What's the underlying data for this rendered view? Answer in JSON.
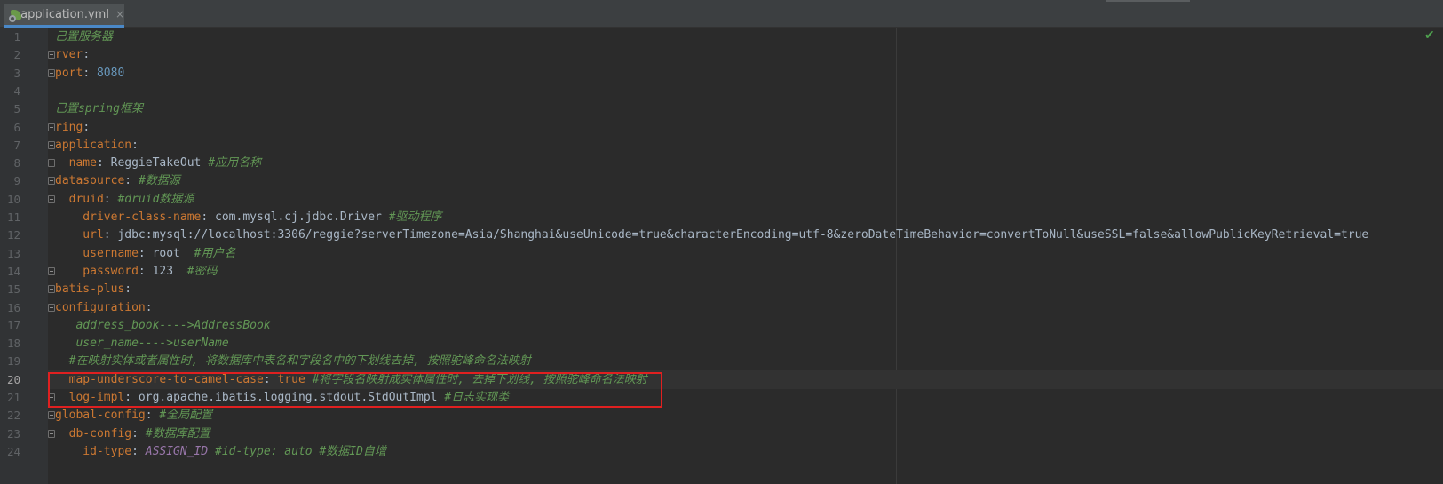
{
  "tab": {
    "label": "application.yml",
    "close": "×"
  },
  "status": {
    "check": "✔"
  },
  "lines": [
    {
      "num": "1",
      "tokens": [
        {
          "t": "c",
          "x": "己置服务器"
        }
      ]
    },
    {
      "num": "2",
      "fold": true,
      "tokens": [
        {
          "t": "k",
          "x": "rver"
        },
        {
          "t": "v",
          "x": ":"
        }
      ]
    },
    {
      "num": "3",
      "fold": true,
      "tokens": [
        {
          "t": "k",
          "x": "port"
        },
        {
          "t": "v",
          "x": ": "
        },
        {
          "t": "n",
          "x": "8080"
        }
      ]
    },
    {
      "num": "4",
      "tokens": []
    },
    {
      "num": "5",
      "tokens": [
        {
          "t": "c",
          "x": "己置spring框架"
        }
      ]
    },
    {
      "num": "6",
      "fold": true,
      "tokens": [
        {
          "t": "k",
          "x": "ring"
        },
        {
          "t": "v",
          "x": ":"
        }
      ]
    },
    {
      "num": "7",
      "fold": true,
      "tokens": [
        {
          "t": "k",
          "x": "application"
        },
        {
          "t": "v",
          "x": ":"
        }
      ]
    },
    {
      "num": "8",
      "fold": true,
      "tokens": [
        {
          "t": "k",
          "x": "  name"
        },
        {
          "t": "v",
          "x": ": ReggieTakeOut "
        },
        {
          "t": "c",
          "x": "#应用名称"
        }
      ]
    },
    {
      "num": "9",
      "fold": true,
      "tokens": [
        {
          "t": "k",
          "x": "datasource"
        },
        {
          "t": "v",
          "x": ": "
        },
        {
          "t": "c",
          "x": "#数据源"
        }
      ]
    },
    {
      "num": "10",
      "fold": true,
      "tokens": [
        {
          "t": "k",
          "x": "  druid"
        },
        {
          "t": "v",
          "x": ": "
        },
        {
          "t": "c",
          "x": "#druid数据源"
        }
      ]
    },
    {
      "num": "11",
      "tokens": [
        {
          "t": "k",
          "x": "    driver-class-name"
        },
        {
          "t": "v",
          "x": ": com.mysql.cj.jdbc.Driver "
        },
        {
          "t": "c",
          "x": "#驱动程序"
        }
      ]
    },
    {
      "num": "12",
      "tokens": [
        {
          "t": "k",
          "x": "    url"
        },
        {
          "t": "v",
          "x": ": jdbc:mysql://localhost:3306/reggie?serverTimezone=Asia/Shanghai&useUnicode=true&characterEncoding=utf-8&zeroDateTimeBehavior=convertToNull&useSSL=false&allowPublicKeyRetrieval=true"
        }
      ]
    },
    {
      "num": "13",
      "tokens": [
        {
          "t": "k",
          "x": "    username"
        },
        {
          "t": "v",
          "x": ": root  "
        },
        {
          "t": "c",
          "x": "#用户名"
        }
      ]
    },
    {
      "num": "14",
      "fold": true,
      "tokens": [
        {
          "t": "k",
          "x": "    password"
        },
        {
          "t": "v",
          "x": ": 123  "
        },
        {
          "t": "c",
          "x": "#密码"
        }
      ]
    },
    {
      "num": "15",
      "fold": true,
      "tokens": [
        {
          "t": "k",
          "x": "batis-plus"
        },
        {
          "t": "v",
          "x": ":"
        }
      ]
    },
    {
      "num": "16",
      "fold": true,
      "tokens": [
        {
          "t": "k",
          "x": "configuration"
        },
        {
          "t": "v",
          "x": ":"
        }
      ]
    },
    {
      "num": "17",
      "tokens": [
        {
          "t": "c",
          "x": "   address_book---->AddressBook"
        }
      ]
    },
    {
      "num": "18",
      "tokens": [
        {
          "t": "c",
          "x": "   user_name---->userName"
        }
      ]
    },
    {
      "num": "19",
      "tokens": [
        {
          "t": "c",
          "x": "  #在映射实体或者属性时, 将数据库中表名和字段名中的下划线去掉, 按照驼峰命名法映射"
        }
      ]
    },
    {
      "num": "20",
      "current": true,
      "tokens": [
        {
          "t": "k",
          "x": "  map-underscore-to-camel-case"
        },
        {
          "t": "v",
          "x": ": "
        },
        {
          "t": "k",
          "x": "true "
        },
        {
          "t": "c",
          "x": "#将字段名映射成实体属性时, 去掉下划线, 按照驼峰命名法映射"
        }
      ]
    },
    {
      "num": "21",
      "fold": true,
      "tokens": [
        {
          "t": "k",
          "x": "  log-impl"
        },
        {
          "t": "v",
          "x": ": org.apache.ibatis.logging.stdout.StdOutImpl "
        },
        {
          "t": "c",
          "x": "#日志实现类"
        }
      ]
    },
    {
      "num": "22",
      "fold": true,
      "tokens": [
        {
          "t": "k",
          "x": "global-config"
        },
        {
          "t": "v",
          "x": ": "
        },
        {
          "t": "c",
          "x": "#全局配置"
        }
      ]
    },
    {
      "num": "23",
      "fold": true,
      "tokens": [
        {
          "t": "k",
          "x": "  db-config"
        },
        {
          "t": "v",
          "x": ": "
        },
        {
          "t": "c",
          "x": "#数据库配置"
        }
      ]
    },
    {
      "num": "24",
      "tokens": [
        {
          "t": "k",
          "x": "    id-type"
        },
        {
          "t": "v",
          "x": ": "
        },
        {
          "t": "a",
          "x": "ASSIGN_ID "
        },
        {
          "t": "c",
          "x": "#id-type: auto #数据ID自增"
        }
      ]
    }
  ]
}
